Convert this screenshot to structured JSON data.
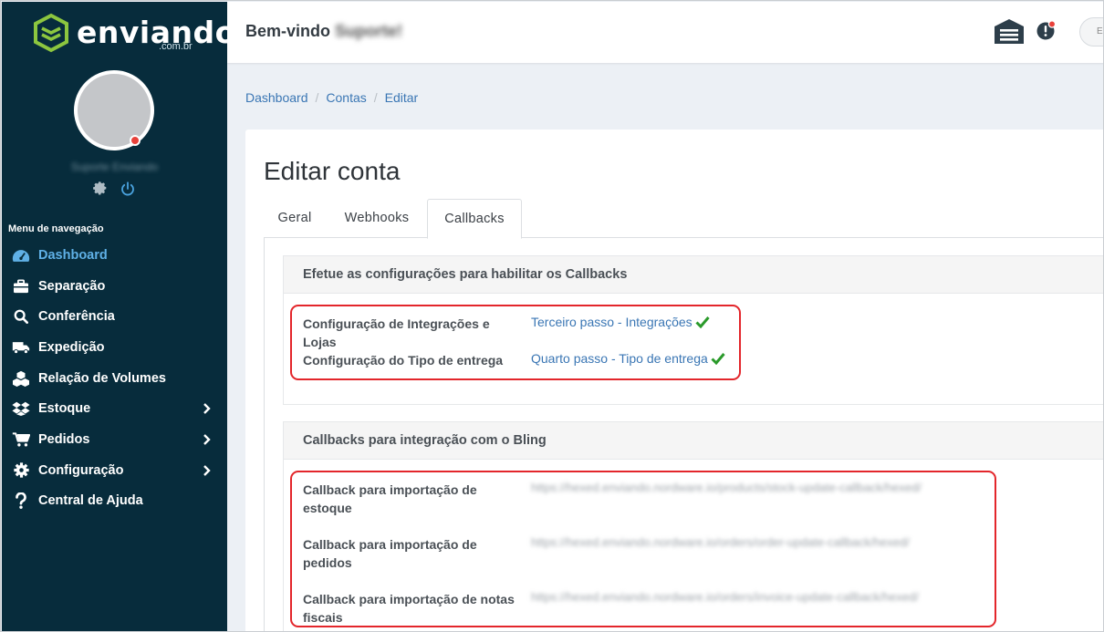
{
  "brand": {
    "name": "enviando",
    "domain": ".com.br",
    "accent": "#8cc63f"
  },
  "sidebar": {
    "user_name": "Suporte Enviando",
    "nav_title": "Menu de navegação",
    "items": [
      {
        "label": "Dashboard",
        "icon": "tachometer-icon",
        "active": true,
        "has_submenu": false
      },
      {
        "label": "Separação",
        "icon": "briefcase-icon",
        "active": false,
        "has_submenu": false
      },
      {
        "label": "Conferência",
        "icon": "search-icon",
        "active": false,
        "has_submenu": false
      },
      {
        "label": "Expedição",
        "icon": "truck-icon",
        "active": false,
        "has_submenu": false
      },
      {
        "label": "Relação de Volumes",
        "icon": "cubes-icon",
        "active": false,
        "has_submenu": false
      },
      {
        "label": "Estoque",
        "icon": "dropbox-icon",
        "active": false,
        "has_submenu": true
      },
      {
        "label": "Pedidos",
        "icon": "cart-icon",
        "active": false,
        "has_submenu": true
      },
      {
        "label": "Configuração",
        "icon": "gear-icon",
        "active": false,
        "has_submenu": true
      },
      {
        "label": "Central de Ajuda",
        "icon": "question-icon",
        "active": false,
        "has_submenu": false
      }
    ]
  },
  "header": {
    "welcome": "Bem-vindo",
    "welcome_name": "Suporte!",
    "button_label": "E"
  },
  "breadcrumb": [
    "Dashboard",
    "Contas",
    "Editar"
  ],
  "main": {
    "title": "Editar conta",
    "tabs": [
      {
        "label": "Geral",
        "active": false
      },
      {
        "label": "Webhooks",
        "active": false
      },
      {
        "label": "Callbacks",
        "active": true
      }
    ],
    "config_panel": {
      "title": "Efetue as configurações para habilitar os Callbacks",
      "rows": [
        {
          "label": "Configuração de Integrações e Lojas",
          "link": "Terceiro passo - Integrações",
          "done": true
        },
        {
          "label": "Configuração do Tipo de entrega",
          "link": "Quarto passo - Tipo de entrega",
          "done": true
        }
      ]
    },
    "callbacks_panel": {
      "title": "Callbacks para integração com o Bling",
      "rows": [
        {
          "label_line1": "Callback para importação de",
          "label_line2": "estoque",
          "url": "https://hexed.enviando.nordware.io/products/stock-update-callback/hexed/"
        },
        {
          "label_line1": "Callback para importação de",
          "label_line2": "pedidos",
          "url": "https://hexed.enviando.nordware.io/orders/order-update-callback/hexed/"
        },
        {
          "label_line1": "Callback para importação de notas",
          "label_line2": "fiscais",
          "url": "https://hexed.enviando.nordware.io/orders/invoice-update-callback/hexed/"
        }
      ]
    }
  },
  "colors": {
    "sidebar_bg": "#072c3c",
    "active_link": "#5fb0e6",
    "link": "#3a76b4",
    "check": "#2a9a2a",
    "highlight": "#e3262b"
  }
}
